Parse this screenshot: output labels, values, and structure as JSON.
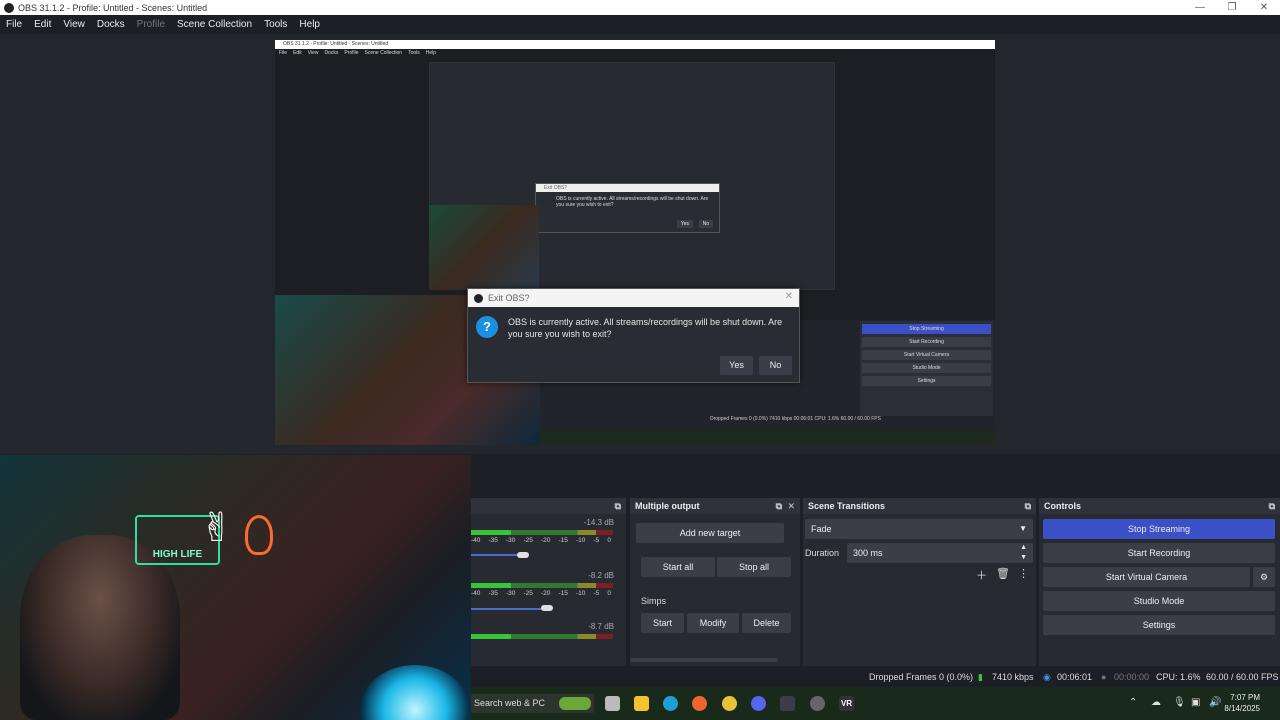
{
  "window": {
    "title": "OBS 31.1.2 - Profile: Untitled - Scenes: Untitled",
    "minimize": "—",
    "maximize": "❐",
    "close": "✕"
  },
  "menu": [
    "File",
    "Edit",
    "View",
    "Docks",
    "Profile",
    "Scene Collection",
    "Tools",
    "Help"
  ],
  "dialog": {
    "title": "Exit OBS?",
    "close": "✕",
    "icon": "?",
    "message": "OBS is currently active. All streams/recordings will be shut down. Are you sure you wish to exit?",
    "yes": "Yes",
    "no": "No"
  },
  "nested": {
    "title": "OBS 31.1.2 - Profile: Untitled - Scenes: Untitled",
    "menu": [
      "File",
      "Edit",
      "View",
      "Docks",
      "Profile",
      "Scene Collection",
      "Tools",
      "Help"
    ],
    "controls": [
      "Stop Streaming",
      "Start Recording",
      "Start Virtual Camera",
      "Studio Mode",
      "Settings"
    ],
    "status": "Dropped Frames 0 (0.0%)   7410 kbps   00:06:01   CPU: 1.6%   60.00 / 60.00 FPS",
    "mini_dialog": {
      "title": "Exit OBS?",
      "message": "OBS is currently active. All streams/recordings will be shut down. Are you sure you wish to exit?",
      "yes": "Yes",
      "no": "No"
    }
  },
  "webcam": {
    "neon_sign": "HIGH LIFE",
    "peace": "✌"
  },
  "audio_mixer": {
    "ticks": [
      "-40",
      "-35",
      "-30",
      "-25",
      "-20",
      "-15",
      "-10",
      "-5",
      "0"
    ],
    "tracks": [
      {
        "db": "-14.3 dB",
        "level": 0.3
      },
      {
        "db": "-8.2 dB",
        "level": 0.3
      },
      {
        "db": "-8.7 dB",
        "level": 0.3
      }
    ]
  },
  "multiple_output": {
    "title": "Multiple output",
    "add_target": "Add new target",
    "start_all": "Start all",
    "stop_all": "Stop all",
    "target_name": "Simps",
    "start": "Start",
    "modify": "Modify",
    "delete": "Delete"
  },
  "scene_transitions": {
    "title": "Scene Transitions",
    "transition": "Fade",
    "duration_label": "Duration",
    "duration_value": "300 ms"
  },
  "controls": {
    "title": "Controls",
    "stop_streaming": "Stop Streaming",
    "start_recording": "Start Recording",
    "start_virtual_camera": "Start Virtual Camera",
    "studio_mode": "Studio Mode",
    "settings": "Settings"
  },
  "status": {
    "dropped_frames": "Dropped Frames 0 (0.0%)",
    "bitrate": "7410 kbps",
    "stream_time": "00:06:01",
    "record_time": "00:00:00",
    "cpu": "CPU: 1.6%",
    "fps": "60.00 / 60.00 FPS"
  },
  "taskbar": {
    "search": "Search web & PC",
    "time": "7:07 PM",
    "date": "8/14/2025",
    "vr_label": "VR"
  },
  "colors": {
    "accent_blue": "#3b4fc7",
    "meter_green": "#37c437",
    "dialog_icon": "#1b8fe0"
  }
}
